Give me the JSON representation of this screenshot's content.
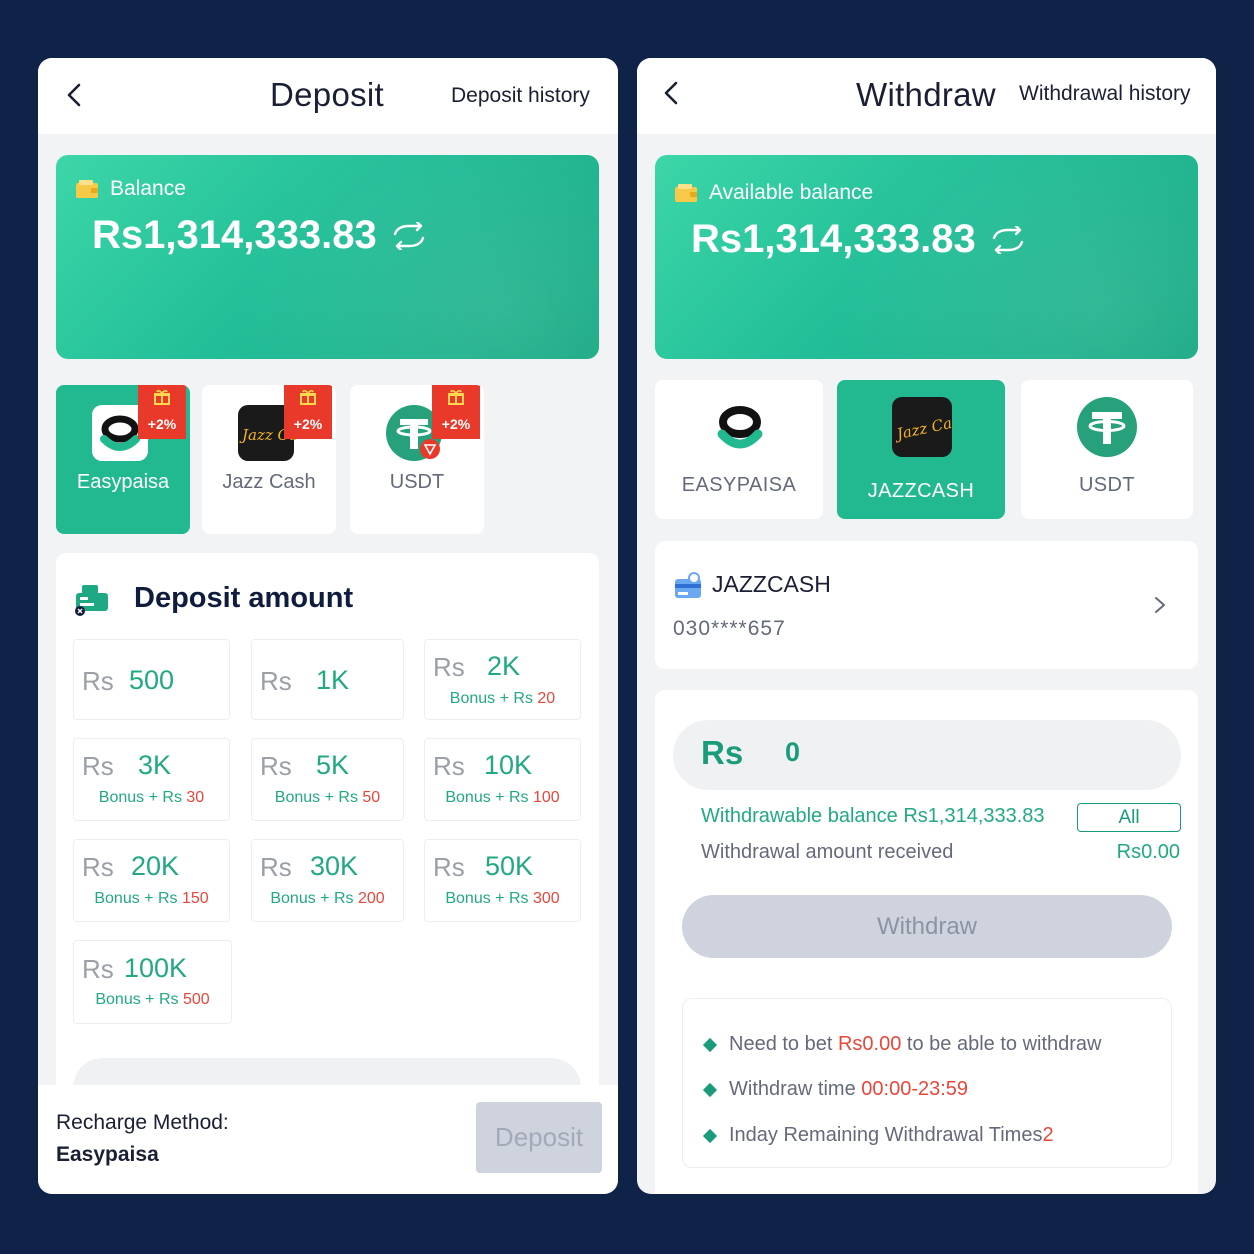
{
  "deposit": {
    "title": "Deposit",
    "history_link": "Deposit history",
    "balance_label": "Balance",
    "balance_amount": "Rs1,314,333.83",
    "methods": [
      {
        "label": "Easypaisa",
        "badge": "+2%",
        "active": true
      },
      {
        "label": "Jazz Cash",
        "badge": "+2%",
        "active": false
      },
      {
        "label": "USDT",
        "badge": "+2%",
        "active": false
      }
    ],
    "amount_title": "Deposit amount",
    "amounts": [
      {
        "currency": "Rs",
        "value": "500",
        "bonus_prefix": "",
        "bonus": ""
      },
      {
        "currency": "Rs",
        "value": "1K",
        "bonus_prefix": "",
        "bonus": ""
      },
      {
        "currency": "Rs",
        "value": "2K",
        "bonus_prefix": "Bonus + Rs ",
        "bonus": "20"
      },
      {
        "currency": "Rs",
        "value": "3K",
        "bonus_prefix": "Bonus + Rs ",
        "bonus": "30"
      },
      {
        "currency": "Rs",
        "value": "5K",
        "bonus_prefix": "Bonus + Rs ",
        "bonus": "50"
      },
      {
        "currency": "Rs",
        "value": "10K",
        "bonus_prefix": "Bonus + Rs ",
        "bonus": "100"
      },
      {
        "currency": "Rs",
        "value": "20K",
        "bonus_prefix": "Bonus + Rs ",
        "bonus": "150"
      },
      {
        "currency": "Rs",
        "value": "30K",
        "bonus_prefix": "Bonus + Rs ",
        "bonus": "200"
      },
      {
        "currency": "Rs",
        "value": "50K",
        "bonus_prefix": "Bonus + Rs ",
        "bonus": "300"
      },
      {
        "currency": "Rs",
        "value": "100K",
        "bonus_prefix": "Bonus + Rs ",
        "bonus": "500"
      }
    ],
    "recharge_method_label": "Recharge Method:",
    "recharge_method_value": "Easypaisa",
    "deposit_button": "Deposit"
  },
  "withdraw": {
    "title": "Withdraw",
    "history_link": "Withdrawal history",
    "balance_label": "Available balance",
    "balance_amount": "Rs1,314,333.83",
    "methods": [
      {
        "label": "EASYPAISA",
        "active": false
      },
      {
        "label": "JAZZCASH",
        "active": true
      },
      {
        "label": "USDT",
        "active": false
      }
    ],
    "account": {
      "name": "JAZZCASH",
      "number": "030****657"
    },
    "input_currency": "Rs",
    "input_value": "0",
    "withdrawable_text": "Withdrawable balance Rs1,314,333.83",
    "all_button": "All",
    "received_label": "Withdrawal amount received",
    "received_value": "Rs0.00",
    "withdraw_button": "Withdraw",
    "rules": {
      "r1_pre": "Need to bet ",
      "r1_red": "Rs0.00",
      "r1_post": " to be able to withdraw",
      "r2_pre": "Withdraw time ",
      "r2_red": "00:00-23:59",
      "r3_pre": "Inday Remaining Withdrawal Times",
      "r3_red": "2"
    }
  },
  "colors": {
    "background": "#0f2248",
    "accent_green": "#22b890",
    "text_green": "#22a984",
    "bonus_red": "#e8473a",
    "badge_red": "#e8392b"
  },
  "icons": [
    "back-icon",
    "wallet-icon",
    "refresh-icon",
    "gift-icon",
    "easypaisa-logo-icon",
    "jazzcash-logo-icon",
    "usdt-logo-icon",
    "cash-register-icon",
    "bank-card-icon",
    "chevron-right-icon"
  ]
}
